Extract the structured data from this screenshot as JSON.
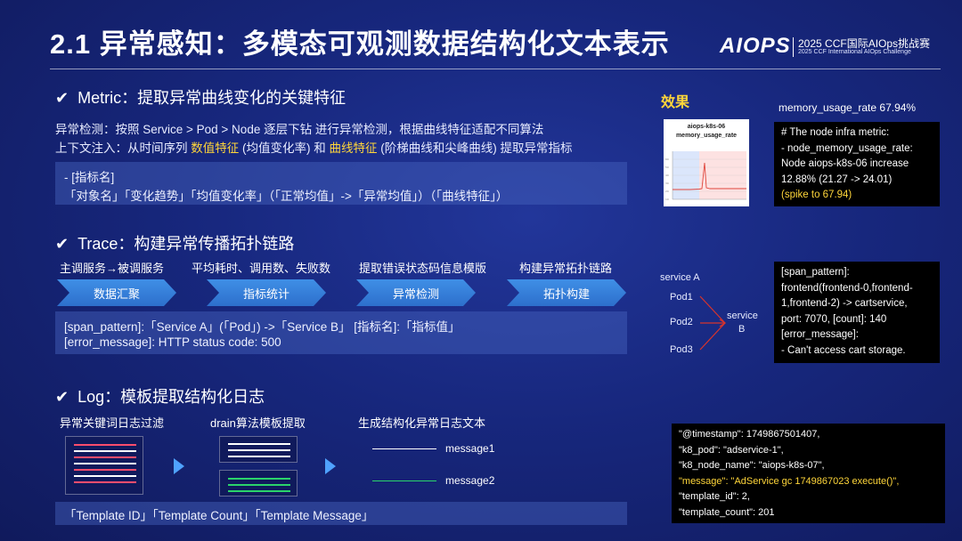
{
  "header": {
    "title": "2.1 异常感知：多模态可观测数据结构化文本表示",
    "logo_text": "AIOPS",
    "logo_line1": "2025 CCF国际AIOps挑战赛",
    "logo_line2": "2025 CCF International AIOps Challenge"
  },
  "metric": {
    "heading": "Metric：提取异常曲线变化的关键特征",
    "line1": "异常检测：按照 Service > Pod > Node 逐层下钻 进行异常检测，根据曲线特征适配不同算法",
    "line2_pre": "上下文注入：从时间序列 ",
    "line2_hl1": "数值特征",
    "line2_mid": " (均值变化率) 和 ",
    "line2_hl2": "曲线特征",
    "line2_post": " (阶梯曲线和尖峰曲线) 提取异常指标",
    "box_line1": "- [指标名]",
    "box_line2": "「对象名」「变化趋势」「均值变化率」（「正常均值」->「异常均值」）（「曲线特征」）"
  },
  "trace": {
    "heading": "Trace：构建异常传播拓扑链路",
    "steps": [
      {
        "caption": "主调服务→被调服务",
        "label": "数据汇聚"
      },
      {
        "caption": "平均耗时、调用数、失败数",
        "label": "指标统计"
      },
      {
        "caption": "提取错误状态码信息模版",
        "label": "异常检测"
      },
      {
        "caption": "构建异常拓扑链路",
        "label": "拓扑构建"
      }
    ],
    "box_line1": "[span_pattern]:「Service A」(「Pod」) ->「Service B」 [指标名]:「指标值」",
    "box_line2": "[error_message]:  HTTP status code: 500"
  },
  "log": {
    "heading": "Log：模板提取结构化日志",
    "captions": [
      "异常关键词日志过滤",
      "drain算法模板提取",
      "生成结构化异常日志文本"
    ],
    "messages": [
      "message1",
      "message2"
    ],
    "box_line": "「Template ID」「Template Count」「Template Message」"
  },
  "effect": {
    "label": "效果",
    "memory_rate": "memory_usage_rate 67.94%",
    "chart_title1": "aiops-k8s-06",
    "chart_title2": "memory_usage_rate",
    "metric_box": [
      "# The node infra metric:",
      "- node_memory_usage_rate:",
      "Node aiops-k8s-06 increase",
      "12.88% (21.27 -> 24.01)",
      "(spike to 67.94)"
    ],
    "topology": {
      "service_a": "service A",
      "pods": [
        "Pod1",
        "Pod2",
        "Pod3"
      ],
      "service_b_1": "service",
      "service_b_2": "B"
    },
    "trace_box": [
      "[span_pattern]:",
      "frontend(frontend-0,frontend-",
      "1,frontend-2) -> cartservice,",
      "port: 7070, [count]: 140",
      "[error_message]:",
      " - Can't access cart storage."
    ],
    "log_box": [
      "\"@timestamp\": 1749867501407,",
      "\"k8_pod\": \"adservice-1\",",
      "\"k8_node_name\": \"aiops-k8s-07\",",
      "\"message\": \"AdService gc 1749867023 execute()\",",
      "\"template_id\": 2,",
      "\"template_count\": 201"
    ]
  },
  "colors": {
    "background": "#17277d",
    "highlight": "#ffd63a",
    "arrow": "#3f8fe6",
    "pink_line": "#ff4d6d",
    "green_line": "#2bd46b"
  },
  "icons": [
    "check-icon",
    "play-arrow-icon",
    "document-icon"
  ]
}
